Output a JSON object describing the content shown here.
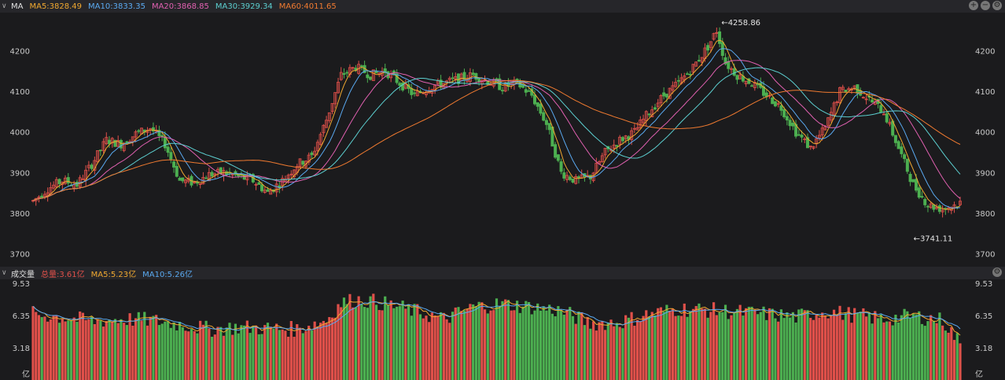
{
  "price_panel": {
    "label": "MA",
    "indicators": [
      {
        "text": "MA5:3828.49",
        "color": "#f0a830"
      },
      {
        "text": "MA10:3833.35",
        "color": "#5aa9f0"
      },
      {
        "text": "MA20:3868.85",
        "color": "#e060b0"
      },
      {
        "text": "MA30:3929.34",
        "color": "#5ccfd0"
      },
      {
        "text": "MA60:4011.65",
        "color": "#f07a30"
      }
    ],
    "high_label": "4258.86",
    "low_label": "3741.11"
  },
  "volume_panel": {
    "label": "成交量",
    "indicators": [
      {
        "text": "总量:3.61亿",
        "color": "#e0504a"
      },
      {
        "text": "MA5:5.23亿",
        "color": "#f0a830"
      },
      {
        "text": "MA10:5.26亿",
        "color": "#5aa9f0"
      }
    ],
    "unit": "亿"
  },
  "colors": {
    "up": "#e0504a",
    "down": "#4caf50",
    "ma5": "#f0a830",
    "ma10": "#5aa9f0",
    "ma20": "#e060b0",
    "ma30": "#5ccfd0",
    "ma60": "#f07a30"
  },
  "chart_data": [
    {
      "type": "candlestick",
      "y_ticks": [
        "4200",
        "4100",
        "4000",
        "3900",
        "3800",
        "3700"
      ],
      "ylim": [
        3670,
        4290
      ],
      "grid": false,
      "anchors": [
        [
          0,
          3830
        ],
        [
          5,
          3860
        ],
        [
          10,
          3880
        ],
        [
          15,
          3870
        ],
        [
          20,
          3920
        ],
        [
          25,
          3980
        ],
        [
          30,
          3970
        ],
        [
          35,
          3995
        ],
        [
          40,
          4010
        ],
        [
          45,
          3970
        ],
        [
          50,
          3880
        ],
        [
          55,
          3875
        ],
        [
          60,
          3895
        ],
        [
          65,
          3900
        ],
        [
          70,
          3890
        ],
        [
          75,
          3880
        ],
        [
          80,
          3850
        ],
        [
          85,
          3880
        ],
        [
          90,
          3920
        ],
        [
          95,
          3940
        ],
        [
          100,
          4030
        ],
        [
          105,
          4140
        ],
        [
          110,
          4160
        ],
        [
          115,
          4140
        ],
        [
          120,
          4150
        ],
        [
          125,
          4120
        ],
        [
          130,
          4090
        ],
        [
          135,
          4110
        ],
        [
          140,
          4120
        ],
        [
          145,
          4130
        ],
        [
          150,
          4140
        ],
        [
          155,
          4125
        ],
        [
          160,
          4110
        ],
        [
          165,
          4120
        ],
        [
          170,
          4090
        ],
        [
          175,
          4020
        ],
        [
          180,
          3900
        ],
        [
          185,
          3880
        ],
        [
          190,
          3890
        ],
        [
          195,
          3950
        ],
        [
          200,
          3980
        ],
        [
          205,
          4000
        ],
        [
          210,
          4050
        ],
        [
          215,
          4090
        ],
        [
          220,
          4120
        ],
        [
          225,
          4160
        ],
        [
          230,
          4210
        ],
        [
          233,
          4250
        ],
        [
          236,
          4170
        ],
        [
          240,
          4140
        ],
        [
          245,
          4120
        ],
        [
          250,
          4090
        ],
        [
          255,
          4060
        ],
        [
          260,
          4000
        ],
        [
          265,
          3960
        ],
        [
          270,
          4010
        ],
        [
          275,
          4100
        ],
        [
          280,
          4110
        ],
        [
          285,
          4080
        ],
        [
          290,
          4050
        ],
        [
          295,
          3960
        ],
        [
          300,
          3870
        ],
        [
          305,
          3820
        ],
        [
          310,
          3810
        ],
        [
          316,
          3825
        ]
      ],
      "candle_count": 317
    },
    {
      "type": "bar",
      "y_ticks": [
        "9.53",
        "6.35",
        "3.18"
      ],
      "ylim": [
        0,
        9.53
      ],
      "anchors": [
        [
          0,
          6.5
        ],
        [
          10,
          6.2
        ],
        [
          20,
          5.8
        ],
        [
          30,
          6.0
        ],
        [
          40,
          5.9
        ],
        [
          50,
          5.5
        ],
        [
          60,
          5.0
        ],
        [
          70,
          5.2
        ],
        [
          80,
          5.1
        ],
        [
          90,
          5.0
        ],
        [
          100,
          5.9
        ],
        [
          105,
          7.6
        ],
        [
          110,
          7.9
        ],
        [
          115,
          7.8
        ],
        [
          120,
          7.5
        ],
        [
          130,
          6.8
        ],
        [
          140,
          6.0
        ],
        [
          150,
          7.2
        ],
        [
          160,
          7.5
        ],
        [
          170,
          7.2
        ],
        [
          180,
          6.8
        ],
        [
          190,
          5.6
        ],
        [
          200,
          5.7
        ],
        [
          210,
          6.5
        ],
        [
          220,
          7.0
        ],
        [
          230,
          6.9
        ],
        [
          240,
          6.7
        ],
        [
          250,
          6.5
        ],
        [
          260,
          6.2
        ],
        [
          270,
          6.8
        ],
        [
          280,
          6.4
        ],
        [
          290,
          6.0
        ],
        [
          300,
          6.3
        ],
        [
          310,
          5.9
        ],
        [
          316,
          3.61
        ]
      ],
      "last_value": 3.61
    }
  ]
}
